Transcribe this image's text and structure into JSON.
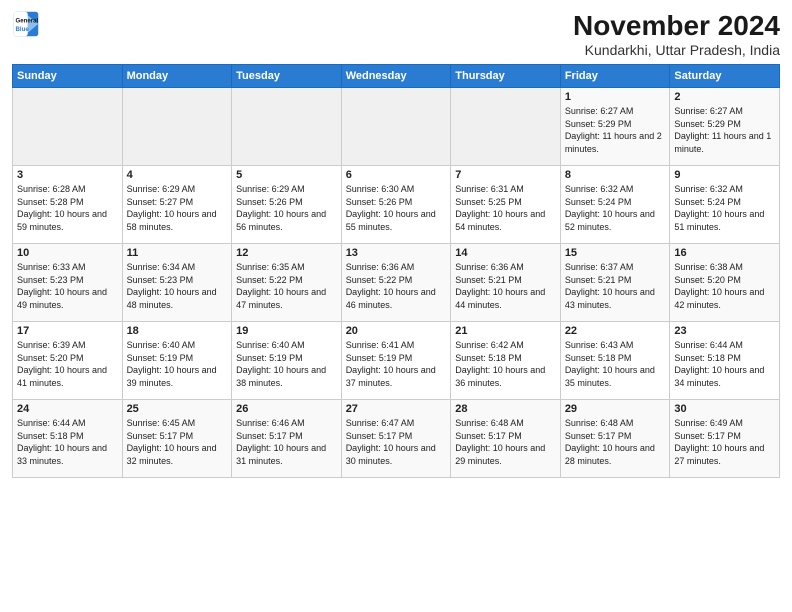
{
  "logo": {
    "line1": "General",
    "line2": "Blue"
  },
  "title": "November 2024",
  "location": "Kundarkhi, Uttar Pradesh, India",
  "weekdays": [
    "Sunday",
    "Monday",
    "Tuesday",
    "Wednesday",
    "Thursday",
    "Friday",
    "Saturday"
  ],
  "weeks": [
    [
      {
        "day": "",
        "info": ""
      },
      {
        "day": "",
        "info": ""
      },
      {
        "day": "",
        "info": ""
      },
      {
        "day": "",
        "info": ""
      },
      {
        "day": "",
        "info": ""
      },
      {
        "day": "1",
        "info": "Sunrise: 6:27 AM\nSunset: 5:29 PM\nDaylight: 11 hours and 2 minutes."
      },
      {
        "day": "2",
        "info": "Sunrise: 6:27 AM\nSunset: 5:29 PM\nDaylight: 11 hours and 1 minute."
      }
    ],
    [
      {
        "day": "3",
        "info": "Sunrise: 6:28 AM\nSunset: 5:28 PM\nDaylight: 10 hours and 59 minutes."
      },
      {
        "day": "4",
        "info": "Sunrise: 6:29 AM\nSunset: 5:27 PM\nDaylight: 10 hours and 58 minutes."
      },
      {
        "day": "5",
        "info": "Sunrise: 6:29 AM\nSunset: 5:26 PM\nDaylight: 10 hours and 56 minutes."
      },
      {
        "day": "6",
        "info": "Sunrise: 6:30 AM\nSunset: 5:26 PM\nDaylight: 10 hours and 55 minutes."
      },
      {
        "day": "7",
        "info": "Sunrise: 6:31 AM\nSunset: 5:25 PM\nDaylight: 10 hours and 54 minutes."
      },
      {
        "day": "8",
        "info": "Sunrise: 6:32 AM\nSunset: 5:24 PM\nDaylight: 10 hours and 52 minutes."
      },
      {
        "day": "9",
        "info": "Sunrise: 6:32 AM\nSunset: 5:24 PM\nDaylight: 10 hours and 51 minutes."
      }
    ],
    [
      {
        "day": "10",
        "info": "Sunrise: 6:33 AM\nSunset: 5:23 PM\nDaylight: 10 hours and 49 minutes."
      },
      {
        "day": "11",
        "info": "Sunrise: 6:34 AM\nSunset: 5:23 PM\nDaylight: 10 hours and 48 minutes."
      },
      {
        "day": "12",
        "info": "Sunrise: 6:35 AM\nSunset: 5:22 PM\nDaylight: 10 hours and 47 minutes."
      },
      {
        "day": "13",
        "info": "Sunrise: 6:36 AM\nSunset: 5:22 PM\nDaylight: 10 hours and 46 minutes."
      },
      {
        "day": "14",
        "info": "Sunrise: 6:36 AM\nSunset: 5:21 PM\nDaylight: 10 hours and 44 minutes."
      },
      {
        "day": "15",
        "info": "Sunrise: 6:37 AM\nSunset: 5:21 PM\nDaylight: 10 hours and 43 minutes."
      },
      {
        "day": "16",
        "info": "Sunrise: 6:38 AM\nSunset: 5:20 PM\nDaylight: 10 hours and 42 minutes."
      }
    ],
    [
      {
        "day": "17",
        "info": "Sunrise: 6:39 AM\nSunset: 5:20 PM\nDaylight: 10 hours and 41 minutes."
      },
      {
        "day": "18",
        "info": "Sunrise: 6:40 AM\nSunset: 5:19 PM\nDaylight: 10 hours and 39 minutes."
      },
      {
        "day": "19",
        "info": "Sunrise: 6:40 AM\nSunset: 5:19 PM\nDaylight: 10 hours and 38 minutes."
      },
      {
        "day": "20",
        "info": "Sunrise: 6:41 AM\nSunset: 5:19 PM\nDaylight: 10 hours and 37 minutes."
      },
      {
        "day": "21",
        "info": "Sunrise: 6:42 AM\nSunset: 5:18 PM\nDaylight: 10 hours and 36 minutes."
      },
      {
        "day": "22",
        "info": "Sunrise: 6:43 AM\nSunset: 5:18 PM\nDaylight: 10 hours and 35 minutes."
      },
      {
        "day": "23",
        "info": "Sunrise: 6:44 AM\nSunset: 5:18 PM\nDaylight: 10 hours and 34 minutes."
      }
    ],
    [
      {
        "day": "24",
        "info": "Sunrise: 6:44 AM\nSunset: 5:18 PM\nDaylight: 10 hours and 33 minutes."
      },
      {
        "day": "25",
        "info": "Sunrise: 6:45 AM\nSunset: 5:17 PM\nDaylight: 10 hours and 32 minutes."
      },
      {
        "day": "26",
        "info": "Sunrise: 6:46 AM\nSunset: 5:17 PM\nDaylight: 10 hours and 31 minutes."
      },
      {
        "day": "27",
        "info": "Sunrise: 6:47 AM\nSunset: 5:17 PM\nDaylight: 10 hours and 30 minutes."
      },
      {
        "day": "28",
        "info": "Sunrise: 6:48 AM\nSunset: 5:17 PM\nDaylight: 10 hours and 29 minutes."
      },
      {
        "day": "29",
        "info": "Sunrise: 6:48 AM\nSunset: 5:17 PM\nDaylight: 10 hours and 28 minutes."
      },
      {
        "day": "30",
        "info": "Sunrise: 6:49 AM\nSunset: 5:17 PM\nDaylight: 10 hours and 27 minutes."
      }
    ]
  ]
}
